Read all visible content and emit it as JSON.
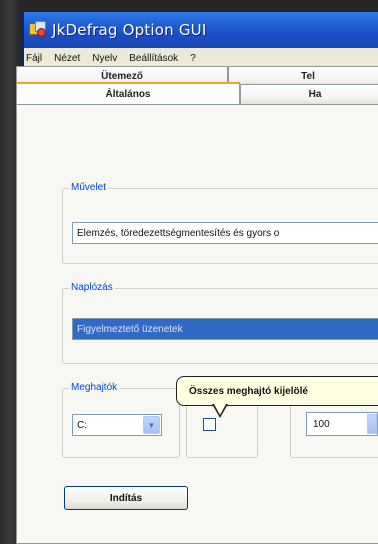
{
  "window": {
    "title": "JkDefrag Option GUI"
  },
  "menu": {
    "items": [
      "Fájl",
      "Nézet",
      "Nyelv",
      "Beállítások",
      "?"
    ]
  },
  "tabs": {
    "row1": [
      {
        "label": "Ütemező"
      },
      {
        "label": "Tel"
      }
    ],
    "row2": [
      {
        "label": "Általános",
        "active": true
      },
      {
        "label": "Ha"
      }
    ]
  },
  "groups": {
    "muvelet": {
      "label": "Művelet",
      "value": "Elemzés, töredezettségmentesítés és gyors o"
    },
    "naplozas": {
      "label": "Naplózás",
      "value": "Figyelmeztető üzenetek"
    },
    "meghajtok": {
      "label": "Meghajtók",
      "value": "C:"
    }
  },
  "tooltip": {
    "text": "Összes meghajtó kijelölé"
  },
  "spin": {
    "value": "100"
  },
  "start_button": {
    "label": "Indítás"
  },
  "colors": {
    "titlebar": "#2465d8",
    "accent_tab": "#f0a22b",
    "highlight": "#316ac5",
    "tooltip_bg": "#ffffe1"
  }
}
